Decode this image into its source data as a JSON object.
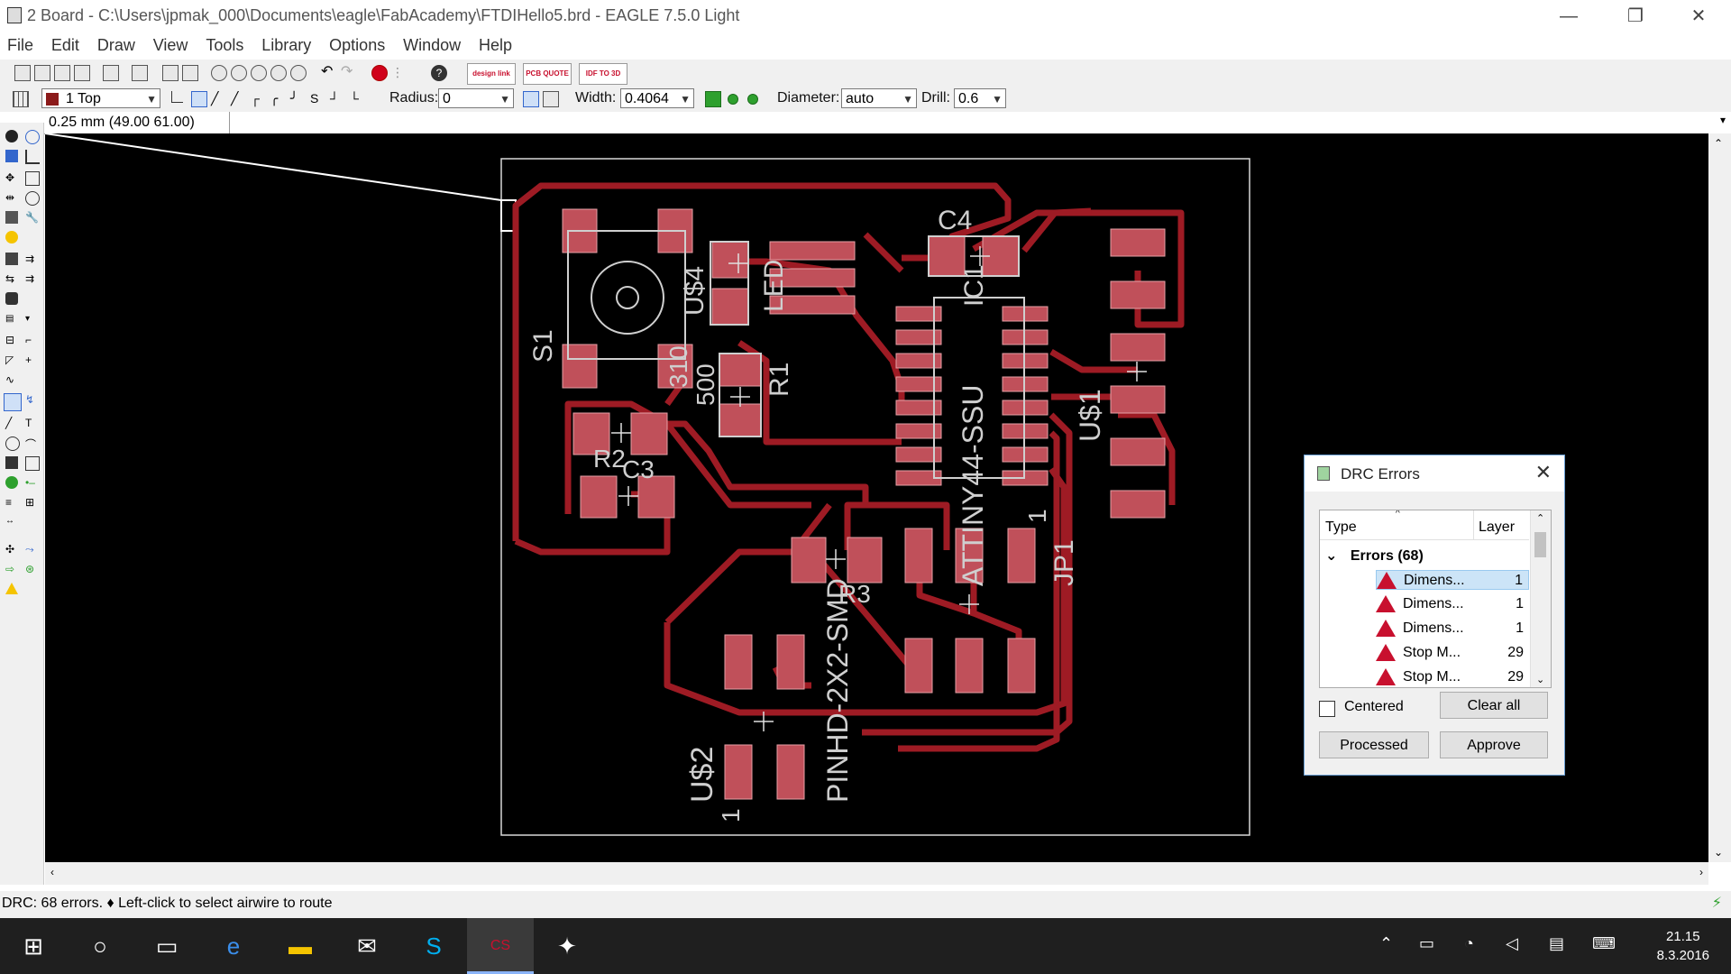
{
  "window": {
    "title": "2 Board - C:\\Users\\jpmak_000\\Documents\\eagle\\FabAcademy\\FTDIHello5.brd - EAGLE 7.5.0 Light",
    "minimize": "—",
    "restore": "❐",
    "close": "✕"
  },
  "menu": [
    "File",
    "Edit",
    "Draw",
    "View",
    "Tools",
    "Library",
    "Options",
    "Window",
    "Help"
  ],
  "toolbar": {
    "badges": [
      "design link",
      "PCB QUOTE",
      "IDF TO 3D"
    ],
    "layer": "1 Top",
    "radius_label": "Radius:",
    "radius_value": "0",
    "width_label": "Width:",
    "width_value": "0.4064",
    "diameter_label": "Diameter:",
    "diameter_value": "auto",
    "drill_label": "Drill:",
    "drill_value": "0.6"
  },
  "coordinates": "0.25 mm (49.00 61.00)",
  "board_labels": {
    "s1": "S1",
    "c4": "C4",
    "c3": "C3",
    "r1": "R1",
    "r2": "R2",
    "r3": "R3",
    "ic1": "IC1",
    "attiny": "ATTINY44-SSU",
    "us1": "U$1",
    "us2": "U$2",
    "us4": "U$4",
    "led": "LED",
    "jp1": "JP1",
    "pinhd": "PINHD-2X2-SMD",
    "v500": "500",
    "v310": "310",
    "one_a": "1",
    "one_b": "1"
  },
  "status": "DRC: 68 errors.  ♦ Left-click to select airwire to route",
  "drc": {
    "title": "DRC Errors",
    "col_type": "Type",
    "col_layer": "Layer",
    "group": "Errors (68)",
    "rows": [
      {
        "name": "Dimens...",
        "layer": "1"
      },
      {
        "name": "Dimens...",
        "layer": "1"
      },
      {
        "name": "Dimens...",
        "layer": "1"
      },
      {
        "name": "Stop M...",
        "layer": "29"
      },
      {
        "name": "Stop M...",
        "layer": "29"
      }
    ],
    "centered": "Centered",
    "clear_all": "Clear all",
    "processed": "Processed",
    "approve": "Approve"
  },
  "clock": {
    "time": "21.15",
    "date": "8.3.2016"
  },
  "colors": {
    "trace": "#9e1b24",
    "pad": "#c0505a",
    "silk": "#cfcfcf",
    "accent": "#c8102e"
  }
}
